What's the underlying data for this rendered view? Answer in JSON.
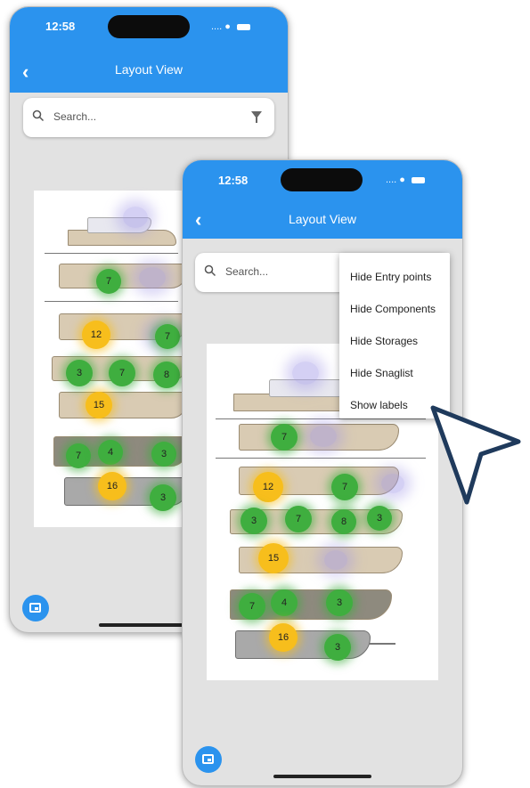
{
  "back_phone": {
    "status_time": "12:58",
    "status_carrier": "....",
    "back_label": "‹",
    "title": "Layout View",
    "search_placeholder": "Search...",
    "markers": [
      "7",
      "12",
      "7",
      "3",
      "7",
      "8",
      "15",
      "7",
      "4",
      "3",
      "16",
      "3"
    ]
  },
  "front_phone": {
    "status_time": "12:58",
    "status_carrier": "....",
    "back_label": "‹",
    "title": "Layout View",
    "search_placeholder": "Search...",
    "menu": [
      "Hide Entry points",
      "Hide Components",
      "Hide Storages",
      "Hide Snaglist",
      "Show labels"
    ],
    "markers": [
      "7",
      "12",
      "7",
      "3",
      "7",
      "8",
      "3",
      "15",
      "7",
      "4",
      "3",
      "16",
      "3"
    ]
  },
  "colors": {
    "app_bar": "#2b93ee",
    "marker_green": "#3fae3f",
    "marker_yellow": "#f7be1c",
    "cursor": "#1f3a5c"
  },
  "icons": [
    "search-icon",
    "filter-icon",
    "chevron-left-icon",
    "wifi-icon",
    "battery-icon",
    "layout-icon",
    "cursor-pointer-icon"
  ]
}
